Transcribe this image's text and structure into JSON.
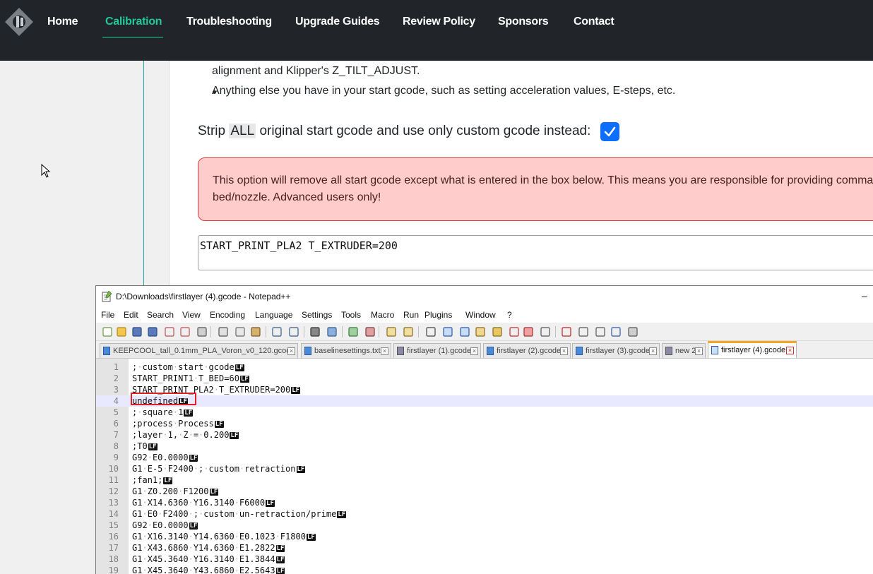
{
  "nav": {
    "items": [
      "Home",
      "Calibration",
      "Troubleshooting",
      "Upgrade Guides",
      "Review Policy",
      "Sponsors",
      "Contact"
    ],
    "active": "Calibration"
  },
  "content": {
    "line_partial": "alignment and Klipper's Z_TILT_ADJUST.",
    "bullet": "Anything else you have in your start gcode, such as setting acceleration values, E-steps, etc.",
    "strip_before": "Strip ",
    "strip_highlight": "ALL",
    "strip_after": " original start gcode and use only custom gcode instead:",
    "checkbox_checked": true,
    "alert_line1": "This option will remove all start gcode except what is entered in the box below. This means you are responsible for providing commands",
    "alert_line2": "bed/nozzle. Advanced users only!",
    "gcode_box_value": "START_PRINT_PLA2 T_EXTRUDER=200"
  },
  "notepad": {
    "title": "D:\\Downloads\\firstlayer (4).gcode - Notepad++",
    "minimize_glyph": "–",
    "menu": [
      "File",
      "Edit",
      "Search",
      "View",
      "Encoding",
      "Language",
      "Settings",
      "Tools",
      "Macro",
      "Run",
      "Plugins",
      "Window",
      "?"
    ],
    "tabs": [
      {
        "label": "KEEPCOOL_tall_0.1mm_PLA_Voron_v0_120.gcode",
        "icon": "blue"
      },
      {
        "label": "baselinesettings.txt",
        "icon": "blue"
      },
      {
        "label": "firstlayer (1).gcode",
        "icon": "gray"
      },
      {
        "label": "firstlayer (2).gcode",
        "icon": "blue"
      },
      {
        "label": "firstlayer (3).gcode",
        "icon": "blue"
      },
      {
        "label": "new 2",
        "icon": "gray"
      },
      {
        "label": "firstlayer (4).gcode",
        "icon": "red",
        "active": true
      }
    ],
    "current_line": 4,
    "lines": [
      "; custom start gcode",
      "START_PRINT1 T_BED=60",
      "START_PRINT_PLA2 T_EXTRUDER=200",
      "undefined",
      "; square 1",
      ";process Process",
      ";layer 1, Z = 0.200",
      ";T0",
      "G92 E0.0000",
      "G1 E-5 F2400 ; custom retraction",
      ";fan1;",
      "G1 Z0.200 F1200",
      "G1 X14.6360 Y16.3140 F6000",
      "G1 E0 F2400 ; custom un-retraction/prime",
      "G92 E0.0000",
      "G1 X16.3140 Y14.6360 E0.1023 F1800",
      "G1 X43.6860 Y14.6360 E1.2822",
      "G1 X45.3640 Y16.3140 E1.3844",
      "G1 X45.3640 Y43.6860 E2.5643"
    ],
    "eol_marker": "LF",
    "whitespace_marker": "·"
  }
}
